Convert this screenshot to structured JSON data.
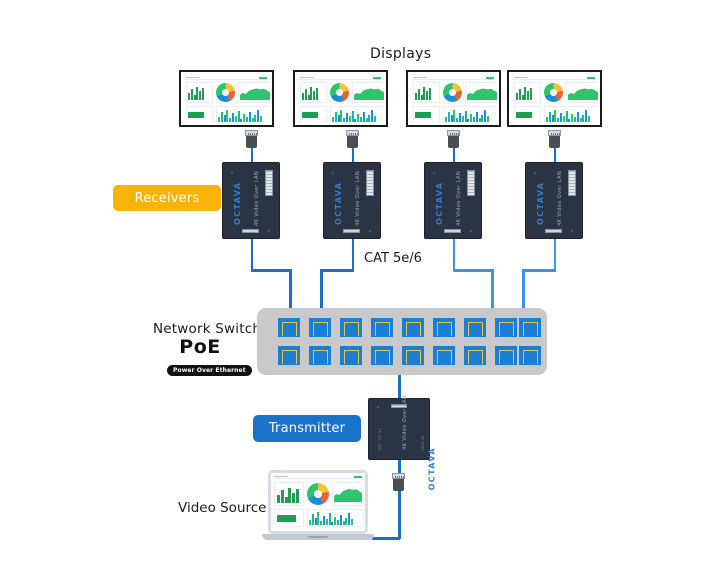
{
  "diagram": {
    "title_displays": "Displays",
    "title_cable": "CAT 5e/6",
    "title_switch": "Network Switch",
    "title_video_source": "Video Source",
    "poe": {
      "abbrev": "PoE",
      "expansion": "Power Over Ethernet"
    },
    "labels": {
      "receivers": "Receivers",
      "transmitter": "Transmitter"
    },
    "colors": {
      "receivers_badge": "#f9b208",
      "transmitter_badge": "#1a73c8",
      "cable": "#1a6fc4",
      "switch_body": "#c9c9c9",
      "port_body": "#1a7fd4",
      "port_outline": "#f2c335",
      "device_body": "#2b3444",
      "brand_blue": "#2f7fd0"
    },
    "devices": {
      "brand": "OCTAVA",
      "receiver_model": "4K Video Over LAN",
      "transmitter_model": "4K Video Over LAN",
      "transmitter_port_label": "HDMI IN",
      "transmitter_power_label": "POE / DC 5V"
    },
    "displays": [
      {
        "name": "display-1"
      },
      {
        "name": "display-2"
      },
      {
        "name": "display-3"
      },
      {
        "name": "display-4"
      }
    ],
    "receivers": [
      {
        "name": "receiver-1"
      },
      {
        "name": "receiver-2"
      },
      {
        "name": "receiver-3"
      },
      {
        "name": "receiver-4"
      }
    ],
    "switch": {
      "port_count": 18,
      "rows": 2,
      "ports_per_row": 9
    }
  }
}
